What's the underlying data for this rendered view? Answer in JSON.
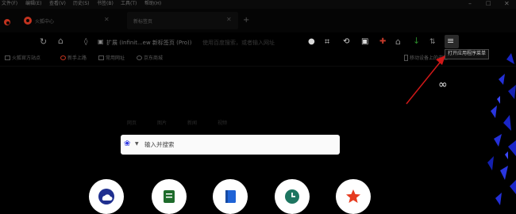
{
  "menu": {
    "items": [
      "文件(F)",
      "编辑(E)",
      "查看(V)",
      "历史(S)",
      "书签(B)",
      "工具(T)",
      "帮助(H)"
    ]
  },
  "tabs": [
    {
      "title": "火狐中心",
      "active": false
    },
    {
      "title": "新标签页",
      "active": true
    }
  ],
  "toolbar": {
    "address_text": "扩展 (Infinit...ew 新标签页 (Pro))",
    "address_hint": "使用百度搜索，或者输入网址"
  },
  "bookmarks": {
    "items": [
      "火狐官方站点",
      "新手上路",
      "常用网址",
      "京东商城"
    ],
    "mobile_label": "移动设备上的书签"
  },
  "tooltip": {
    "text": "打开应用程序菜单"
  },
  "newtab": {
    "infinity_symbol": "∞",
    "nav": [
      "网页",
      "图片",
      "新闻",
      "视频"
    ],
    "search_placeholder": "输入并搜索"
  },
  "quick_links": [
    {
      "name": "weather",
      "icon": "weather-cloud-icon",
      "color": "#1f2f8f"
    },
    {
      "name": "notes",
      "icon": "notes-icon",
      "color": "#1e6b2b"
    },
    {
      "name": "bookmarks",
      "icon": "bookmark-icon",
      "color": "#1f63d6"
    },
    {
      "name": "history",
      "icon": "clock-icon",
      "color": "#1d7560"
    },
    {
      "name": "favorites",
      "icon": "star-icon",
      "color": "#e63b1f"
    }
  ],
  "colors": {
    "annotation_arrow": "#d01818",
    "search_engine_icon": "#2932e1"
  }
}
